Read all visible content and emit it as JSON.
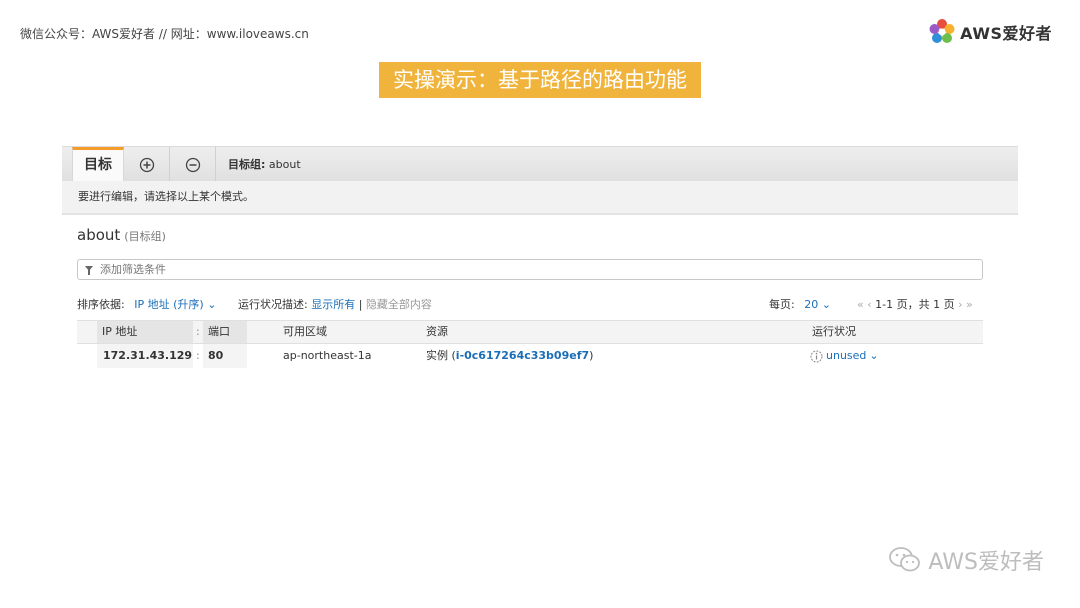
{
  "header": {
    "note": "微信公众号：AWS爱好者  //  网址：www.iloveaws.cn",
    "brand": "AWS爱好者"
  },
  "slide": {
    "title": "实操演示：基于路径的路由功能"
  },
  "tabs": {
    "active_label": "目标",
    "add_icon": "plus-circle-icon",
    "remove_icon": "minus-circle-icon",
    "target_group_prefix": "目标组:",
    "target_group_name": "about"
  },
  "hint": "要进行编辑，请选择以上某个模式。",
  "group": {
    "title": "about",
    "subtitle": "(目标组)"
  },
  "filter": {
    "placeholder": "添加筛选条件"
  },
  "controls": {
    "sort_label": "排序依据:",
    "sort_value": "IP 地址 (升序)",
    "health_label": "运行状况描述:",
    "show_all": "显示所有",
    "divider": "|",
    "hide_all": "隐藏全部内容",
    "per_page_label": "每页:",
    "per_page_value": "20",
    "page_text": "1-1 页，共 1 页"
  },
  "table": {
    "headers": [
      "IP 地址",
      "端口",
      "可用区域",
      "资源",
      "运行状况"
    ],
    "rows": [
      {
        "ip": "172.31.43.129",
        "port": "80",
        "az": "ap-northeast-1a",
        "resource_prefix": "实例 (",
        "instance_id": "i-0c617264c33b09ef7",
        "resource_suffix": ")",
        "status": "unused"
      }
    ]
  },
  "watermark": "AWS爱好者",
  "colors": {
    "accent": "#f0b43c",
    "tab_border": "#f39c29",
    "link": "#1a6eb8"
  }
}
